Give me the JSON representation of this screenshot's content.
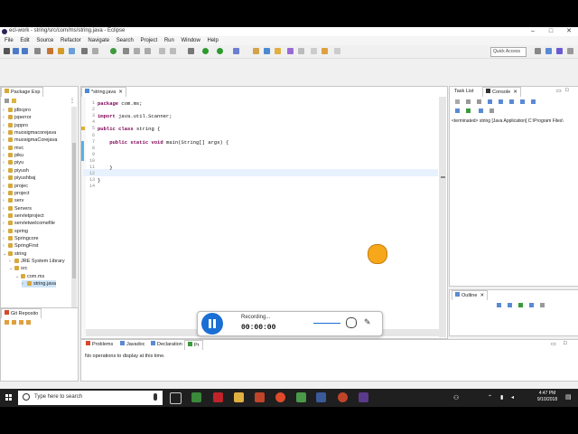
{
  "window": {
    "title": "ecl-work - string/src/com/ms/string.java - Eclipse",
    "controls": [
      "minimize-icon",
      "maximize-icon",
      "close-icon"
    ]
  },
  "menu": [
    "File",
    "Edit",
    "Source",
    "Refactor",
    "Navigate",
    "Search",
    "Project",
    "Run",
    "Window",
    "Help"
  ],
  "toolbar": {
    "quick_access_placeholder": "Quick Access"
  },
  "package_explorer": {
    "tab_label": "Package Exp",
    "items": [
      {
        "label": "jdbcpro",
        "depth": 0,
        "expanded": false
      },
      {
        "label": "jsperror",
        "depth": 0,
        "expanded": false
      },
      {
        "label": "jsppro",
        "depth": 0,
        "expanded": false
      },
      {
        "label": "muosigmacorejava",
        "depth": 0,
        "expanded": false
      },
      {
        "label": "muosigmaCorejava",
        "depth": 0,
        "expanded": false
      },
      {
        "label": "mvc",
        "depth": 0,
        "expanded": false
      },
      {
        "label": "piku",
        "depth": 0,
        "expanded": false
      },
      {
        "label": "piyu",
        "depth": 0,
        "expanded": false
      },
      {
        "label": "piyush",
        "depth": 0,
        "expanded": false
      },
      {
        "label": "piyushbaj",
        "depth": 0,
        "expanded": false
      },
      {
        "label": "projec",
        "depth": 0,
        "expanded": false
      },
      {
        "label": "project",
        "depth": 0,
        "expanded": false
      },
      {
        "label": "serv",
        "depth": 0,
        "expanded": false
      },
      {
        "label": "Servers",
        "depth": 0,
        "expanded": false
      },
      {
        "label": "servletproject",
        "depth": 0,
        "expanded": false
      },
      {
        "label": "servletwelcomefile",
        "depth": 0,
        "expanded": false
      },
      {
        "label": "spring",
        "depth": 0,
        "expanded": false
      },
      {
        "label": "Springcore",
        "depth": 0,
        "expanded": false
      },
      {
        "label": "SpringFirst",
        "depth": 0,
        "expanded": false
      },
      {
        "label": "string",
        "depth": 0,
        "expanded": true
      },
      {
        "label": "JRE System Library",
        "depth": 1,
        "expanded": false
      },
      {
        "label": "src",
        "depth": 1,
        "expanded": true
      },
      {
        "label": "com.ms",
        "depth": 2,
        "expanded": true
      },
      {
        "label": "string.java",
        "depth": 3,
        "expanded": false,
        "selected": true
      }
    ]
  },
  "git_repos": {
    "tab_label": "Git Reposito"
  },
  "editor": {
    "tab_label": "*string.java",
    "lines": [
      {
        "num": "1",
        "text": "package com.ms;"
      },
      {
        "num": "2",
        "text": ""
      },
      {
        "num": "3",
        "text": "import java.util.Scanner;"
      },
      {
        "num": "4",
        "text": ""
      },
      {
        "num": "5",
        "text": "public class string {"
      },
      {
        "num": "6",
        "text": ""
      },
      {
        "num": "7",
        "text": "    public static void main(String[] args) {"
      },
      {
        "num": "8",
        "text": ""
      },
      {
        "num": "9",
        "text": ""
      },
      {
        "num": "10",
        "text": ""
      },
      {
        "num": "11",
        "text": "    }"
      },
      {
        "num": "12",
        "text": ""
      },
      {
        "num": "13",
        "text": "}"
      },
      {
        "num": "14",
        "text": ""
      }
    ]
  },
  "right_panel": {
    "tabs": [
      "Task List",
      "Console"
    ],
    "console_text": "<terminated> string [Java Application] C:\\Program Files\\"
  },
  "outline": {
    "tab_label": "Outline"
  },
  "bottom_panel": {
    "tabs": [
      "Problems",
      "Javadoc",
      "Declaration",
      "Pr"
    ],
    "message": "No operations to display at this time."
  },
  "recorder": {
    "status": "Recording...",
    "time": "00:00:00"
  },
  "taskbar": {
    "search_placeholder": "Type here to search",
    "time": "4:47 PM",
    "date": "9/10/2018"
  },
  "colors": {
    "keyword": "#7f0055",
    "accent": "#1a6fd4",
    "cursor_highlight": "#f6a81a"
  }
}
